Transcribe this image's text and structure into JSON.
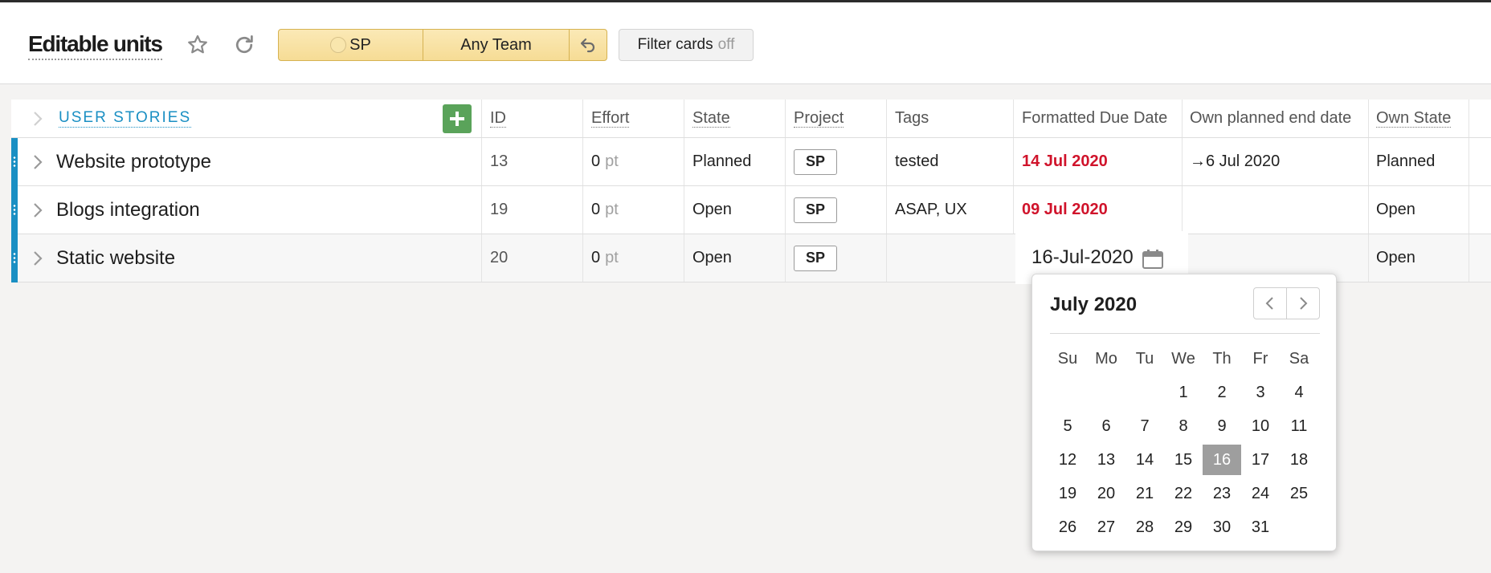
{
  "header": {
    "title": "Editable units",
    "segment_sp": "SP",
    "segment_team": "Any Team",
    "filter_label": "Filter cards",
    "filter_state": "off"
  },
  "columns": {
    "name": "USER STORIES",
    "id": "ID",
    "effort": "Effort",
    "state": "State",
    "project": "Project",
    "tags": "Tags",
    "due": "Formatted Due Date",
    "planned_end": "Own planned end date",
    "own_state": "Own State"
  },
  "rows": [
    {
      "name": "Website prototype",
      "id": "13",
      "effort": "0",
      "unit": "pt",
      "state": "Planned",
      "project": "SP",
      "tags": "tested",
      "due": "14 Jul 2020",
      "planned_end": "→6 Jul 2020",
      "own_state": "Planned"
    },
    {
      "name": "Blogs integration",
      "id": "19",
      "effort": "0",
      "unit": "pt",
      "state": "Open",
      "project": "SP",
      "tags": "ASAP, UX",
      "due": "09 Jul 2020",
      "planned_end": "",
      "own_state": "Open"
    },
    {
      "name": "Static website",
      "id": "20",
      "effort": "0",
      "unit": "pt",
      "state": "Open",
      "project": "SP",
      "tags": "",
      "due": "",
      "planned_end": "",
      "own_state": "Open"
    }
  ],
  "date_input": {
    "value": "16-Jul-2020"
  },
  "calendar": {
    "month_label": "July 2020",
    "weekdays": [
      "Su",
      "Mo",
      "Tu",
      "We",
      "Th",
      "Fr",
      "Sa"
    ],
    "first_weekday_index": 3,
    "days_in_month": 31,
    "selected_day": 16
  },
  "colors": {
    "accent": "#1a8fc3",
    "overdue": "#d0132b",
    "add_button": "#5aa35a",
    "selected_day": "#9e9e9e"
  }
}
